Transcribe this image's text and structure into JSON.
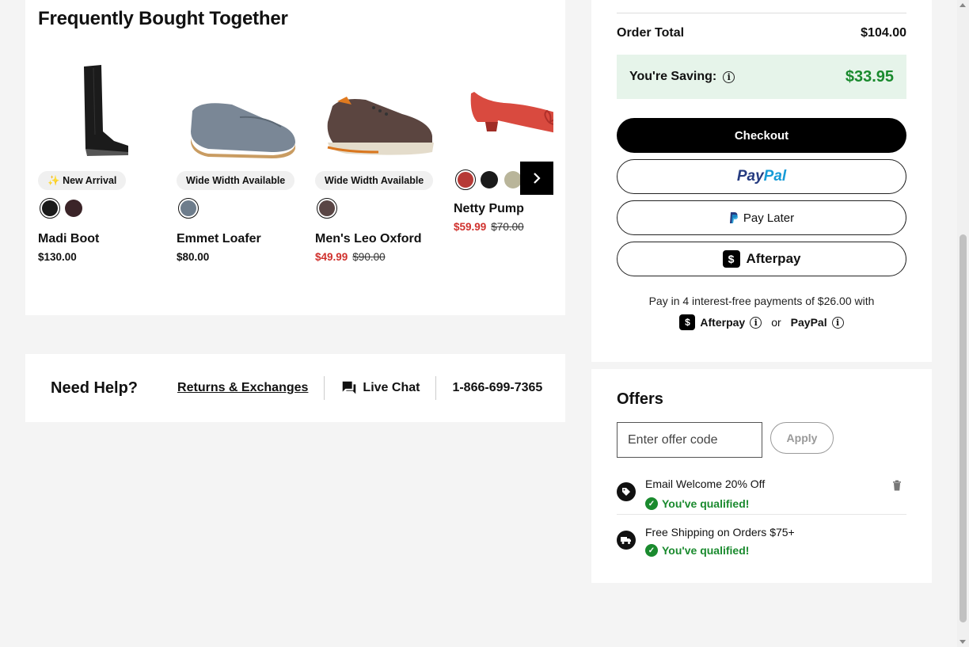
{
  "fbt": {
    "title": "Frequently Bought Together",
    "products": [
      {
        "name": "Madi Boot",
        "price": "$130.00",
        "badge": "New Arrival",
        "swatches": [
          "#1a1a1a",
          "#3b2428"
        ],
        "on_sale": false
      },
      {
        "name": "Emmet Loafer",
        "price": "$80.00",
        "badge": "Wide Width Available",
        "swatches": [
          "#6e7d8c"
        ],
        "on_sale": false
      },
      {
        "name": "Men's Leo Oxford",
        "sale_price": "$49.99",
        "original_price": "$90.00",
        "badge": "Wide Width Available",
        "swatches": [
          "#5a4645"
        ],
        "on_sale": true
      },
      {
        "name": "Netty Pump",
        "sale_price": "$59.99",
        "original_price": "$70.00",
        "badge": "",
        "swatches": [
          "#b63a36",
          "#1a1a1a",
          "#b9b59a"
        ],
        "on_sale": true
      }
    ]
  },
  "help": {
    "title": "Need Help?",
    "returns": "Returns & Exchanges",
    "chat": "Live Chat",
    "phone": "1-866-699-7365"
  },
  "summary": {
    "total_label": "Order Total",
    "total_value": "$104.00",
    "saving_label": "You're Saving:",
    "saving_value": "$33.95",
    "checkout": "Checkout",
    "paypal_1": "Pay",
    "paypal_2": "Pal",
    "pay_later": "Pay Later",
    "afterpay": "Afterpay",
    "installments": "Pay in 4 interest-free payments of $26.00 with",
    "afterpay_small": "Afterpay",
    "or": "or",
    "paypal_small": "PayPal"
  },
  "offers": {
    "title": "Offers",
    "placeholder": "Enter offer code",
    "apply": "Apply",
    "items": [
      {
        "name": "Email Welcome 20% Off",
        "status": "You've qualified!"
      },
      {
        "name": "Free Shipping on Orders $75+",
        "status": "You've qualified!"
      }
    ]
  },
  "colors": {
    "saving_bg": "#e6f4ea",
    "green": "#1a8a2e",
    "sale_red": "#d0312d"
  }
}
